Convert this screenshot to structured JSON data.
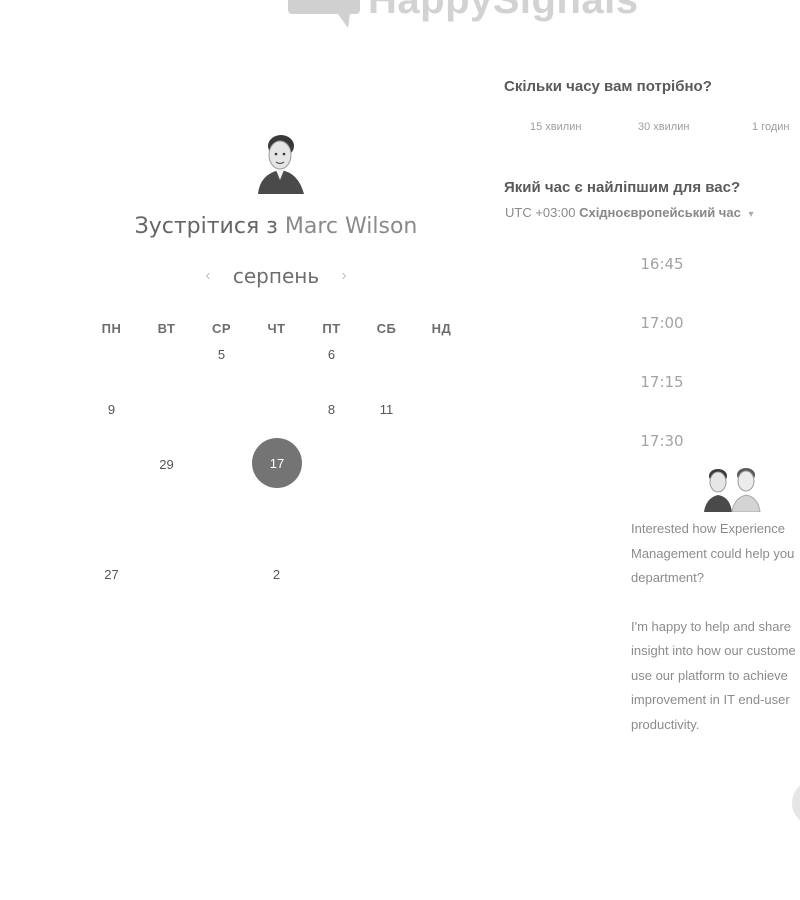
{
  "logo": {
    "text": "HappySignals"
  },
  "host": {
    "title_prefix": "Зустрітися з",
    "name": "Marc Wilson"
  },
  "calendar": {
    "month": "серпень",
    "prev_icon": "chevron-left-icon",
    "next_icon": "chevron-right-icon",
    "weekdays": [
      "ПН",
      "ВТ",
      "СР",
      "ЧТ",
      "ПТ",
      "СБ",
      "НД"
    ],
    "rows": [
      [
        "",
        "",
        "5",
        "",
        "6",
        "",
        ""
      ],
      [
        "9",
        "",
        "",
        "",
        "8",
        "11",
        ""
      ],
      [
        "",
        "29",
        "",
        "17",
        "",
        "",
        ""
      ],
      [
        "",
        "",
        "",
        "",
        "",
        "",
        ""
      ],
      [
        "27",
        "",
        "",
        "2",
        "",
        "",
        ""
      ]
    ],
    "selected": "17"
  },
  "duration": {
    "question": "Скільки часу вам потрібно?",
    "options": [
      "15 хвилин",
      "30 хвилин",
      "1 годин"
    ]
  },
  "time": {
    "question": "Який час є найліпшим для вас?",
    "timezone_offset": "UTC +03:00",
    "timezone_name": "Східноєвропейський час",
    "slots": [
      "16:45",
      "17:00",
      "17:15",
      "17:30"
    ]
  },
  "promo": {
    "paragraph1_lines": [
      "Interested how Experience",
      "Management could help you",
      "department?"
    ],
    "paragraph2_lines": [
      "I'm happy to help and share",
      "insight into how our custome",
      "use our platform to achieve",
      "improvement in IT end-user",
      "productivity."
    ]
  },
  "colors": {
    "selected_day": "#747474",
    "text_dark": "#555555",
    "text_muted": "#a3a3a3"
  }
}
